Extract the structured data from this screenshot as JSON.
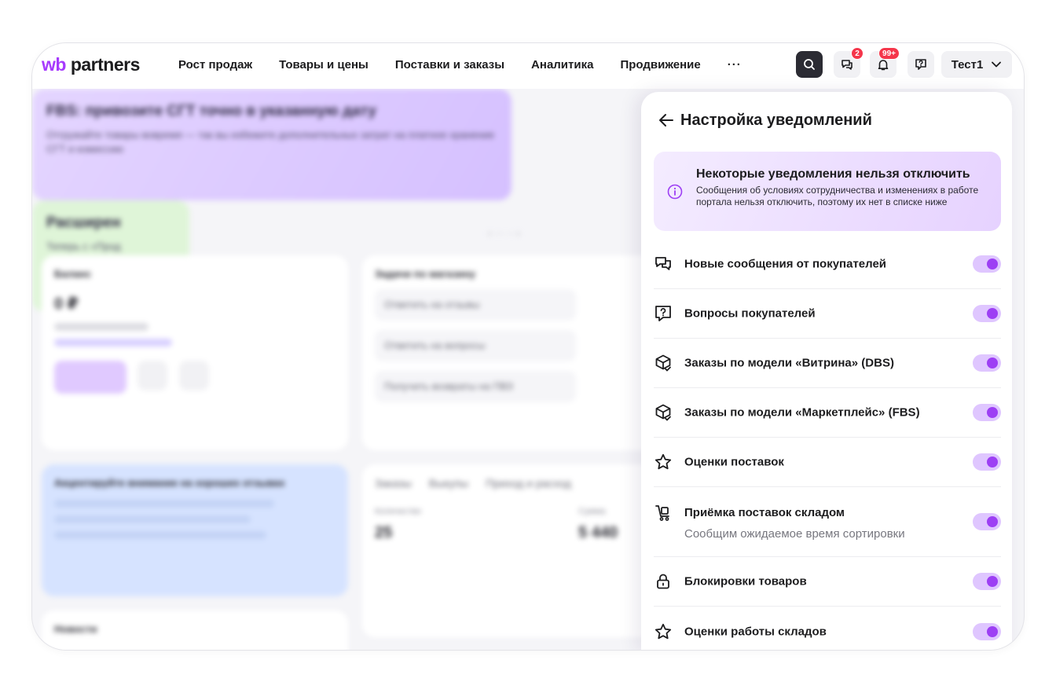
{
  "header": {
    "logo_wb": "wb",
    "logo_partners": "partners",
    "nav": [
      "Рост продаж",
      "Товары и цены",
      "Поставки и заказы",
      "Аналитика",
      "Продвижение"
    ],
    "more_label": "···",
    "chat_badge": "2",
    "bell_badge": "99+",
    "user_label": "Тест1"
  },
  "background": {
    "promo1_title": "FBS: привозите СГТ точно в указанную дату",
    "promo1_text": "Отгружайте товары вовремя — так вы избежите дополнительных затрат на платное хранение СГТ и комиссию",
    "promo2_title": "Расширен",
    "promo2_text": "Теперь с «Прод себестоимость",
    "balance_title": "Баланс",
    "balance_value": "0 ₽",
    "tasks_title": "Задачи по магазину",
    "tasks": [
      "Ответить на отзывы",
      "Ответить на вопросы",
      "Получить возвраты на ПВЗ"
    ],
    "accent_title": "Акцентируйте внимание на хороших отзывах",
    "orders_tabs": [
      "Заказы",
      "Выкупы",
      "Приход и расход"
    ],
    "orders_count_label": "Количество",
    "orders_count": "25",
    "orders_sum_label": "Сумма",
    "orders_sum": "5 440",
    "news_title": "Новости"
  },
  "panel": {
    "title": "Настройка уведомлений",
    "info_title": "Некоторые уведомления нельзя отключить",
    "info_text": "Сообщения об условиях сотрудничества и изменениях в работе портала нельзя отключить, поэтому их нет в списке ниже",
    "items": [
      {
        "label": "Новые сообщения от покупателей",
        "icon": "chat-icon",
        "enabled": true
      },
      {
        "label": "Вопросы покупателей",
        "icon": "question-icon",
        "enabled": true
      },
      {
        "label": "Заказы по модели «Витрина» (DBS)",
        "icon": "box-icon",
        "enabled": true
      },
      {
        "label": "Заказы по модели «Маркетплейс» (FBS)",
        "icon": "box-icon",
        "enabled": true
      },
      {
        "label": "Оценки поставок",
        "icon": "star-icon",
        "enabled": true
      },
      {
        "label": "Приёмка поставок складом",
        "sub": "Сообщим ожидаемое время сортировки",
        "icon": "cart-icon",
        "enabled": true
      },
      {
        "label": "Блокировки товаров",
        "icon": "lock-icon",
        "enabled": true
      },
      {
        "label": "Оценки работы складов",
        "icon": "star-icon",
        "enabled": true
      }
    ]
  },
  "colors": {
    "brand": "#a73afd",
    "toggle_on": "#9d3ff4",
    "toggle_track": "#dfc6ff",
    "badge": "#f5364b"
  }
}
